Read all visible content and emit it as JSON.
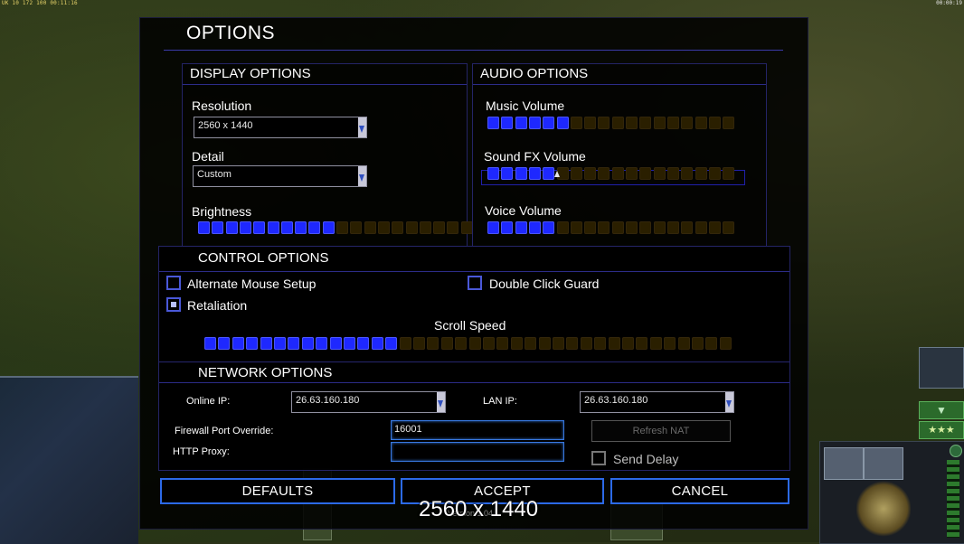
{
  "hud": {
    "top_left_stats": "UK 10 172 100 00:11:16",
    "top_right_time": "00:00:19"
  },
  "dialog": {
    "title": "OPTIONS",
    "display": {
      "title": "DISPLAY OPTIONS",
      "resolution_label": "Resolution",
      "resolution_value": "2560 x 1440",
      "detail_label": "Detail",
      "detail_value": "Custom",
      "brightness_label": "Brightness",
      "brightness_level": {
        "filled": 10,
        "total": 20
      }
    },
    "audio": {
      "title": "AUDIO OPTIONS",
      "music_label": "Music Volume",
      "music_level": {
        "filled": 6,
        "total": 18
      },
      "sfx_label": "Sound FX Volume",
      "sfx_level": {
        "filled": 5,
        "total": 18
      },
      "voice_label": "Voice Volume",
      "voice_level": {
        "filled": 5,
        "total": 18
      }
    },
    "control": {
      "title": "CONTROL OPTIONS",
      "alt_mouse_label": "Alternate Mouse Setup",
      "alt_mouse_checked": false,
      "double_click_label": "Double Click Guard",
      "double_click_checked": false,
      "retaliation_label": "Retaliation",
      "retaliation_checked": true,
      "scroll_label": "Scroll Speed",
      "scroll_level": {
        "filled": 14,
        "total": 38
      }
    },
    "network": {
      "title": "NETWORK OPTIONS",
      "online_ip_label": "Online IP:",
      "online_ip_value": "26.63.160.180",
      "lan_ip_label": "LAN IP:",
      "lan_ip_value": "26.63.160.180",
      "firewall_label": "Firewall Port Override:",
      "firewall_value": "16001",
      "proxy_label": "HTTP Proxy:",
      "proxy_value": "",
      "refresh_nat_label": "Refresh NAT",
      "send_delay_label": "Send Delay",
      "send_delay_checked": false
    },
    "buttons": {
      "defaults": "DEFAULTS",
      "accept": "ACCEPT",
      "cancel": "CANCEL"
    },
    "version": "Version 1.04"
  },
  "overlay_resolution": "2560 x 1440",
  "icons": [
    "satellite-icon",
    "chevron-down-icon",
    "rank-stars-icon",
    "general-emblem-icon"
  ],
  "colors": {
    "accent": "#2c6ae8",
    "slider_on": "#1e28ff",
    "slider_off": "#2a1f00",
    "panel_border": "#242466"
  }
}
